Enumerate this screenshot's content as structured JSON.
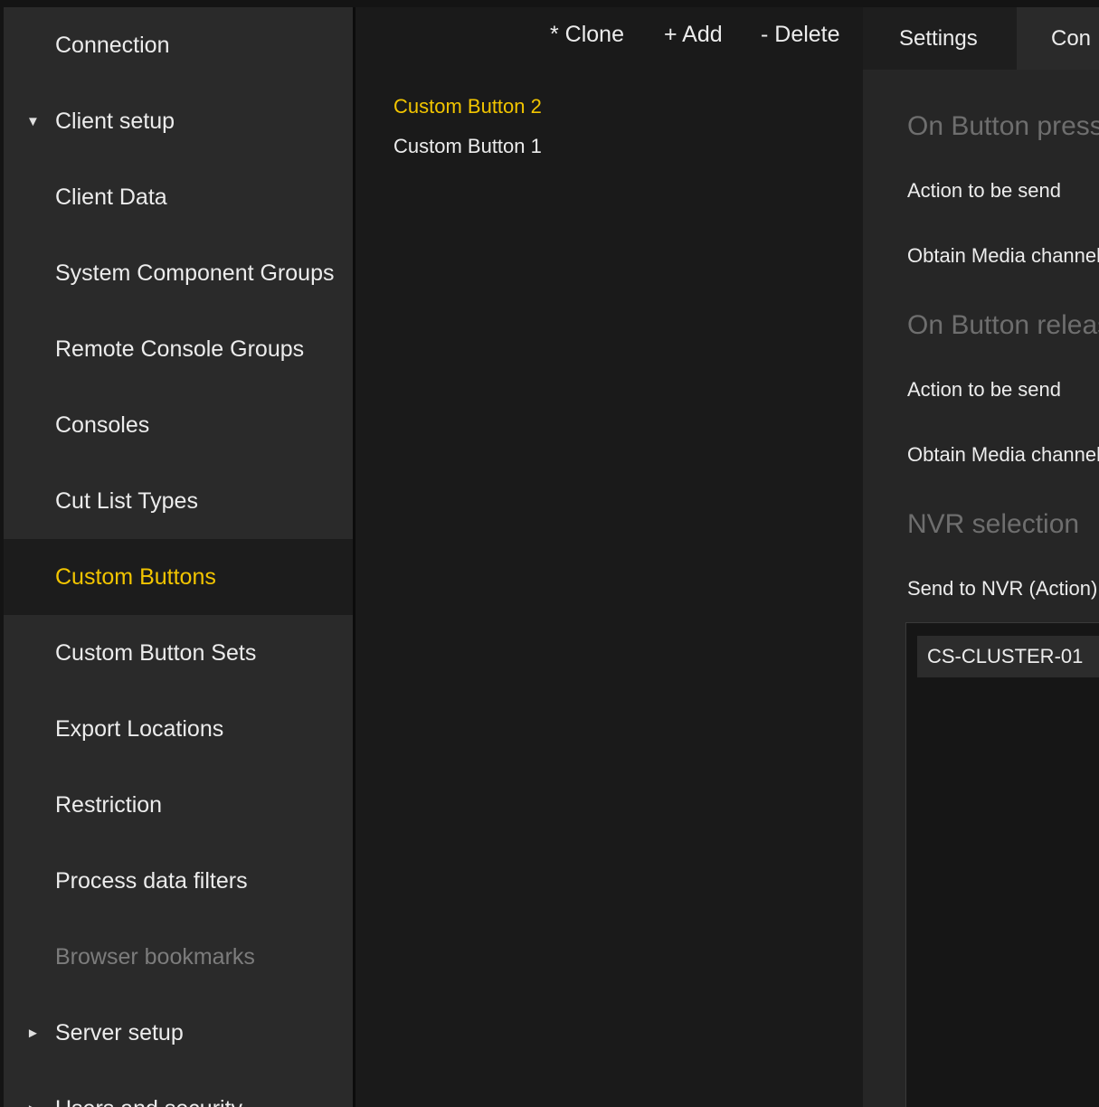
{
  "sidebar": {
    "items": [
      {
        "label": "Connection",
        "arrow": "",
        "state": "normal"
      },
      {
        "label": "Client setup",
        "arrow": "▼",
        "state": "normal"
      },
      {
        "label": "Client Data",
        "arrow": "",
        "state": "normal"
      },
      {
        "label": "System Component Groups",
        "arrow": "",
        "state": "normal"
      },
      {
        "label": "Remote Console Groups",
        "arrow": "",
        "state": "normal"
      },
      {
        "label": "Consoles",
        "arrow": "",
        "state": "normal"
      },
      {
        "label": "Cut List Types",
        "arrow": "",
        "state": "normal"
      },
      {
        "label": "Custom Buttons",
        "arrow": "",
        "state": "active"
      },
      {
        "label": "Custom Button Sets",
        "arrow": "",
        "state": "normal"
      },
      {
        "label": "Export Locations",
        "arrow": "",
        "state": "normal"
      },
      {
        "label": "Restriction",
        "arrow": "",
        "state": "normal"
      },
      {
        "label": "Process data filters",
        "arrow": "",
        "state": "normal"
      },
      {
        "label": "Browser bookmarks",
        "arrow": "",
        "state": "disabled"
      },
      {
        "label": "Server setup",
        "arrow": "►",
        "state": "normal"
      },
      {
        "label": "Users and security",
        "arrow": "►",
        "state": "normal"
      }
    ]
  },
  "toolbar": {
    "clone_label": "* Clone",
    "add_label": "+ Add",
    "delete_label": "- Delete"
  },
  "button_list": {
    "items": [
      {
        "label": "Custom Button 2",
        "selected": true
      },
      {
        "label": "Custom Button 1",
        "selected": false
      }
    ]
  },
  "tabs": {
    "settings": "Settings",
    "second": "Con"
  },
  "details": {
    "press_section": "On Button press",
    "press_action_label": "Action to be send",
    "press_media_label": "Obtain Media channel",
    "release_section": "On Button release",
    "release_action_label": "Action to be send",
    "release_media_label": "Obtain Media channel",
    "nvr_section": "NVR selection",
    "nvr_send_label": "Send to NVR (Action)",
    "nvr_items": [
      "CS-CLUSTER-01"
    ]
  },
  "colors": {
    "accent": "#f2c500",
    "sidebar_bg": "#2a2a2a",
    "active_bg": "#1c1c1c",
    "middle_bg": "#1a1a1a",
    "panel_bg": "#262626"
  }
}
